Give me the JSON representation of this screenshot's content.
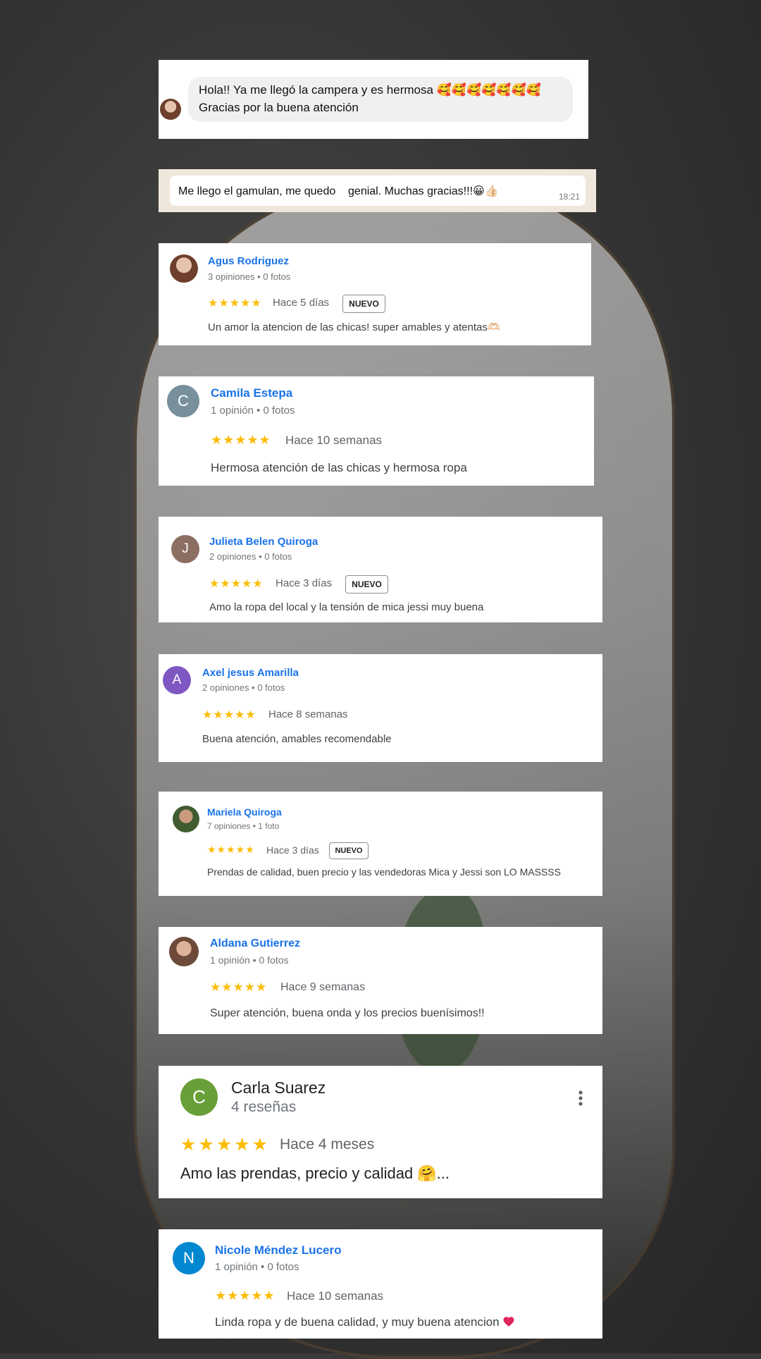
{
  "chat1": {
    "line1": "Hola!! Ya me llegó la campera y es hermosa 🥰🥰🥰🥰🥰🥰🥰",
    "line2": "Gracias por la buena atención"
  },
  "chat2": {
    "message": "Me llego el gamulan, me quedo    genial. Muchas gracias!!!😀👍🏻",
    "time": "18:21"
  },
  "reviews": [
    {
      "name": "Agus Rodriguez",
      "meta": "3 opiniones • 0 fotos",
      "stars": "★★★★★",
      "date": "Hace 5 días",
      "badge": "NUEVO",
      "text": "Un amor la atencion de las chicas! super amables y atentas🫶🏻"
    },
    {
      "name": "Camila Estepa",
      "initial": "C",
      "meta": "1 opinión • 0 fotos",
      "stars": "★★★★★",
      "date": "Hace 10 semanas",
      "text": "Hermosa atención de las chicas y hermosa ropa"
    },
    {
      "name": "Julieta Belen Quiroga",
      "initial": "J",
      "meta": "2 opiniones • 0 fotos",
      "stars": "★★★★★",
      "date": "Hace 3 días",
      "badge": "NUEVO",
      "text": "Amo la ropa del local y la tensión de mica jessi muy buena"
    },
    {
      "name": "Axel jesus Amarilla",
      "initial": "A",
      "meta": "2 opiniones • 0 fotos",
      "stars": "★★★★★",
      "date": "Hace 8 semanas",
      "text": "Buena atención, amables recomendable"
    },
    {
      "name": "Mariela Quiroga",
      "meta": "7 opiniones • 1 foto",
      "stars": "★★★★★",
      "date": "Hace 3 días",
      "badge": "NUEVO",
      "text": "Prendas de calidad, buen precio y las vendedoras Mica y Jessi son LO MASSSS"
    },
    {
      "name": "Aldana Gutierrez",
      "meta": "1 opinión • 0 fotos",
      "stars": "★★★★★",
      "date": "Hace 9 semanas",
      "text": "Super atención, buena onda y los precios buenísimos!!"
    },
    {
      "name": "Carla Suarez",
      "initial": "C",
      "meta": "4 reseñas",
      "stars": "★★★★★",
      "date": "Hace 4 meses",
      "text": "Amo las prendas, precio y calidad 🤗..."
    },
    {
      "name": "Nicole Méndez Lucero",
      "initial": "N",
      "meta": "1 opinión • 0 fotos",
      "stars": "★★★★★",
      "date": "Hace 10 semanas",
      "text": "Linda ropa y de buena calidad, y muy buena atencion"
    }
  ],
  "icons": {
    "more": "more-vert-icon",
    "heart": "heart-icon"
  },
  "colors": {
    "name_blue": "#1a73e8",
    "star_yellow": "#fbbc04",
    "meta_gray": "#70757a",
    "heart_red": "#e0245e"
  }
}
